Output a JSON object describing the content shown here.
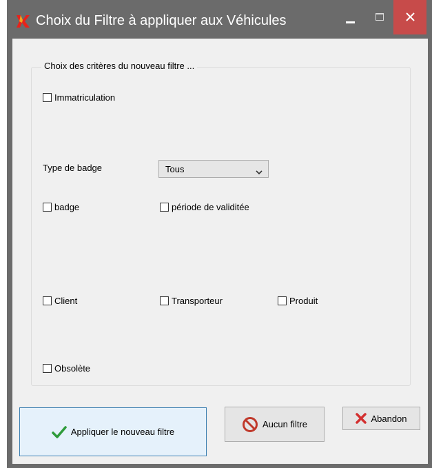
{
  "window": {
    "title": "Choix du Filtre à appliquer aux Véhicules",
    "app_icon": "app-logo-icon",
    "controls": [
      "minimize-icon",
      "maximize-icon",
      "close-icon"
    ]
  },
  "group": {
    "legend": "Choix des critères du nouveau filtre ..."
  },
  "criteria": {
    "immatriculation": {
      "label": "Immatriculation",
      "checked": false
    },
    "type_badge": {
      "label": "Type de badge",
      "selected": "Tous"
    },
    "badge": {
      "label": "badge",
      "checked": false
    },
    "periode": {
      "label": "période de validitée",
      "checked": false
    },
    "client": {
      "label": "Client",
      "checked": false
    },
    "transporteur": {
      "label": "Transporteur",
      "checked": false
    },
    "produit": {
      "label": "Produit",
      "checked": false
    },
    "obsolete": {
      "label": "Obsolète",
      "checked": false
    }
  },
  "buttons": {
    "apply": {
      "label": "Appliquer le nouveau filtre",
      "icon": "checkmark-icon",
      "color": "#2e9b3a"
    },
    "none": {
      "label": "Aucun filtre",
      "icon": "prohibited-icon",
      "color": "#c0392b"
    },
    "abort": {
      "label": "Abandon",
      "icon": "red-x-icon",
      "color": "#d32f2f"
    }
  },
  "colors": {
    "titlebar": "#6b6b6b",
    "close_button": "#c74b4a",
    "dialog_bg": "#f0f0f0"
  }
}
